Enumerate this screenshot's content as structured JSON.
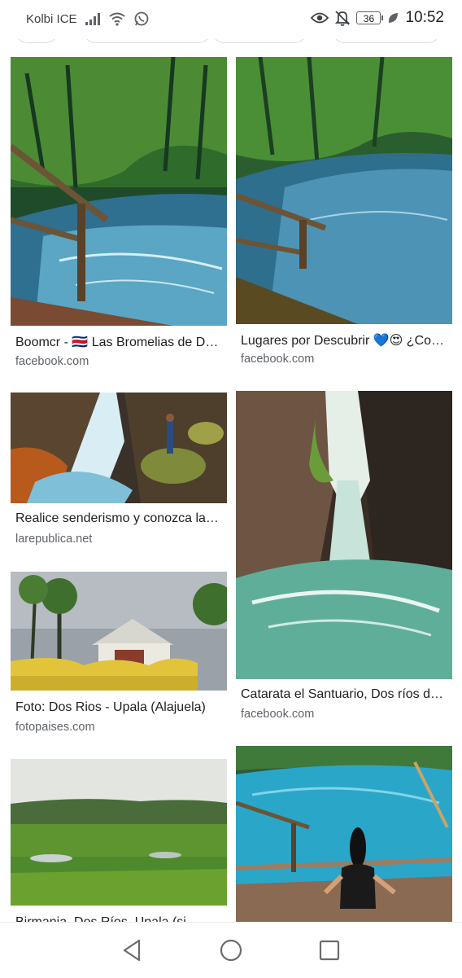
{
  "status_bar": {
    "carrier": "Kolbi ICE",
    "battery": "36",
    "time": "10:52",
    "icons": [
      "signal-icon",
      "wifi-icon",
      "whatsapp-icon",
      "eye-icon",
      "bell-off-icon",
      "battery-icon",
      "leaf-icon"
    ]
  },
  "results": [
    {
      "title": "Boomcr - 🇨🇷 Las Bromelias de Dos Ríos",
      "source": "facebook.com"
    },
    {
      "title": "Lugares por Descubrir 💙😍 ¿Conoces este lugar?",
      "source": "facebook.com"
    },
    {
      "title": "Realice senderismo y conozca las cataratas",
      "source": "larepublica.net"
    },
    {
      "title": "Catarata el Santuario, Dos ríos de Upala",
      "source": "facebook.com"
    },
    {
      "title": "Foto: Dos Rios - Upala (Alajuela)",
      "source": "fotopaises.com"
    },
    {
      "title": "Birmania, Dos Ríos, Upala (si...",
      "source": ""
    },
    {
      "title": "",
      "source": ""
    }
  ],
  "nav": {
    "icons": [
      "back-icon",
      "home-icon",
      "recents-icon"
    ]
  },
  "colors": {
    "text": "#202124",
    "secondary": "#5f6368",
    "water": "#3f8fb3",
    "foliage": "#3f7d2e"
  }
}
